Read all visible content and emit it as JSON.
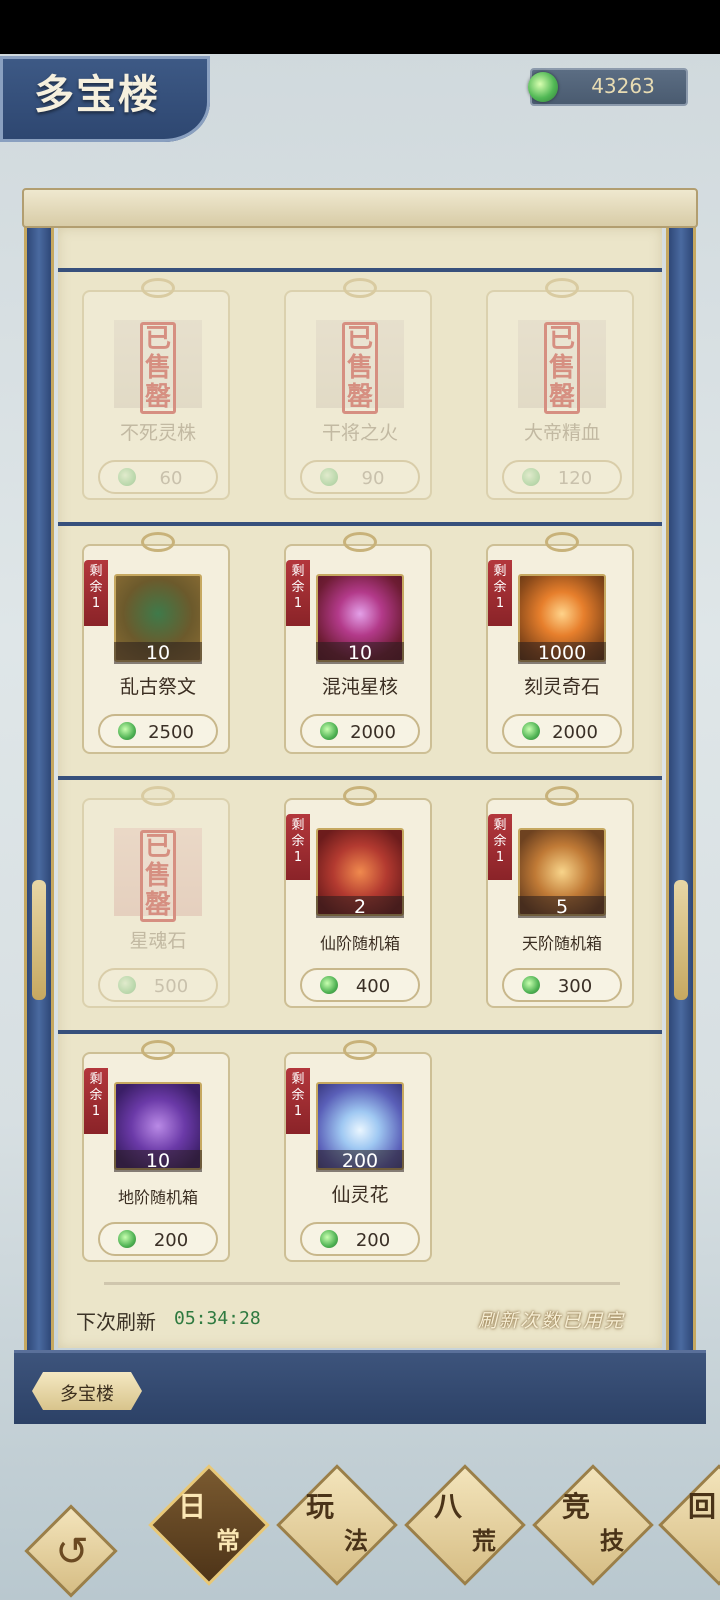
{
  "header": {
    "title": "多宝楼"
  },
  "currency": {
    "icon": "jade-coin-icon",
    "value": "43263"
  },
  "shop": {
    "items": [
      {
        "name": "不死灵株",
        "price": "60",
        "sold_out": true,
        "sold_label": "已售罄"
      },
      {
        "name": "干将之火",
        "price": "90",
        "sold_out": true,
        "sold_label": "已售罄"
      },
      {
        "name": "大帝精血",
        "price": "120",
        "sold_out": true,
        "sold_label": "已售罄"
      },
      {
        "name": "乱古祭文",
        "price": "2500",
        "count": "10",
        "remain_label": "剩余",
        "remain": "1",
        "sold_out": false,
        "icon": "scroll-book-icon"
      },
      {
        "name": "混沌星核",
        "price": "2000",
        "count": "10",
        "remain_label": "剩余",
        "remain": "1",
        "sold_out": false,
        "icon": "star-core-icon"
      },
      {
        "name": "刻灵奇石",
        "price": "2000",
        "count": "1000",
        "remain_label": "剩余",
        "remain": "1",
        "sold_out": false,
        "icon": "spirit-stone-icon"
      },
      {
        "name": "星魂石",
        "price": "500",
        "sold_out": true,
        "sold_label": "已售罄"
      },
      {
        "name": "仙阶随机箱",
        "price": "400",
        "count": "2",
        "remain_label": "剩余",
        "remain": "1",
        "sold_out": false,
        "icon": "red-box-icon"
      },
      {
        "name": "天阶随机箱",
        "price": "300",
        "count": "5",
        "remain_label": "剩余",
        "remain": "1",
        "sold_out": false,
        "icon": "gold-box-icon"
      },
      {
        "name": "地阶随机箱",
        "price": "200",
        "count": "10",
        "remain_label": "剩余",
        "remain": "1",
        "sold_out": false,
        "icon": "purple-box-icon"
      },
      {
        "name": "仙灵花",
        "price": "200",
        "count": "200",
        "remain_label": "剩余",
        "remain": "1",
        "sold_out": false,
        "icon": "lotus-icon"
      }
    ]
  },
  "refresh": {
    "label": "下次刷新",
    "time": "05:34:28",
    "exhausted": "刷新次数已用完"
  },
  "tab": {
    "label": "多宝楼"
  },
  "nav": [
    {
      "top": "日",
      "bottom": "常",
      "active": true
    },
    {
      "top": "玩",
      "bottom": "法",
      "active": false
    },
    {
      "top": "八",
      "bottom": "荒",
      "active": false
    },
    {
      "top": "竞",
      "bottom": "技",
      "active": false
    },
    {
      "top": "回",
      "bottom": "",
      "active": false
    }
  ],
  "colors": {
    "accent_gold": "#c6a860",
    "scroll_blue": "#37507c",
    "remain_red": "#b3373c",
    "sold_red": "#c23b3b",
    "timer_green": "#2f7a40"
  }
}
